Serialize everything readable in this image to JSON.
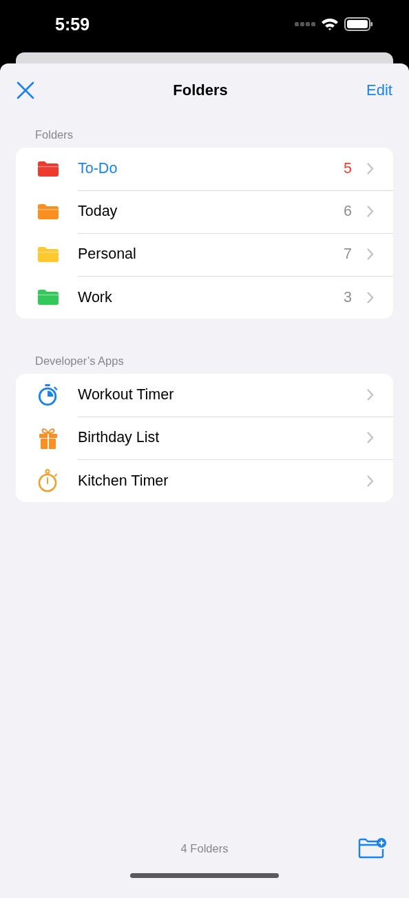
{
  "status_bar": {
    "time": "5:59"
  },
  "nav": {
    "title": "Folders",
    "edit": "Edit"
  },
  "folders": {
    "header": "Folders",
    "items": [
      {
        "name": "To-Do",
        "count": "5",
        "color": "#f03a2e",
        "selected": true
      },
      {
        "name": "Today",
        "count": "6",
        "color": "#fb8f22",
        "selected": false
      },
      {
        "name": "Personal",
        "count": "7",
        "color": "#fdc92e",
        "selected": false
      },
      {
        "name": "Work",
        "count": "3",
        "color": "#34c759",
        "selected": false
      }
    ]
  },
  "apps": {
    "header": "Developer’s Apps",
    "items": [
      {
        "name": "Workout Timer",
        "kind": "stopwatch",
        "color": "#1a82f0"
      },
      {
        "name": "Birthday List",
        "kind": "gift",
        "color": "#fb8f22"
      },
      {
        "name": "Kitchen Timer",
        "kind": "timer",
        "color": "#f0a02e"
      }
    ]
  },
  "toolbar": {
    "count": "4 Folders"
  }
}
